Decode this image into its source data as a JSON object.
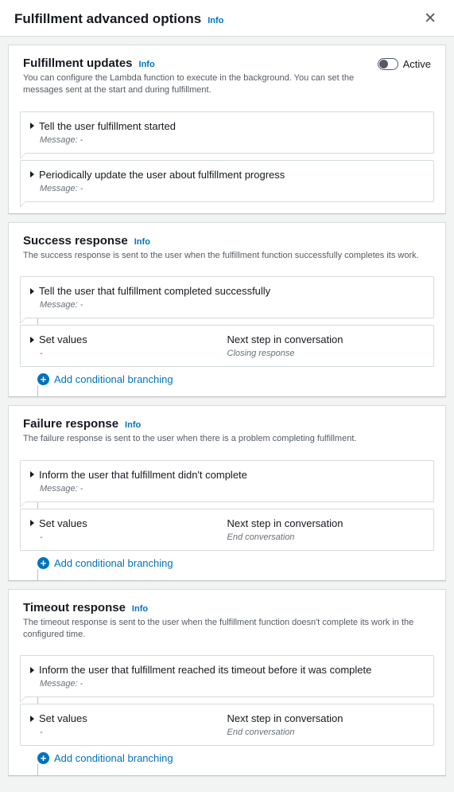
{
  "header": {
    "title": "Fulfillment advanced options",
    "info": "Info"
  },
  "sections": {
    "updates": {
      "title": "Fulfillment updates",
      "info": "Info",
      "desc": "You can configure the Lambda function to execute in the background. You can set the messages sent at the start and during fulfillment.",
      "toggle_label": "Active",
      "rows": {
        "started": {
          "title": "Tell the user fulfillment started",
          "msg": "Message: -"
        },
        "progress": {
          "title": "Periodically update the user about fulfillment progress",
          "msg": "Message: -"
        }
      }
    },
    "success": {
      "title": "Success response",
      "info": "Info",
      "desc": "The success response is sent to the user when the fulfillment function successfully completes its work.",
      "rows": {
        "tell": {
          "title": "Tell the user that fulfillment completed successfully",
          "msg": "Message: -"
        },
        "set": {
          "title": "Set values",
          "sub": "-"
        },
        "next": {
          "title": "Next step in conversation",
          "sub": "Closing response"
        }
      },
      "add": "Add conditional branching"
    },
    "failure": {
      "title": "Failure response",
      "info": "Info",
      "desc": "The failure response is sent to the user when there is a problem completing fulfillment.",
      "rows": {
        "tell": {
          "title": "Inform the user that fulfillment didn't complete",
          "msg": "Message: -"
        },
        "set": {
          "title": "Set values",
          "sub": "-"
        },
        "next": {
          "title": "Next step in conversation",
          "sub": "End conversation"
        }
      },
      "add": "Add conditional branching"
    },
    "timeout": {
      "title": "Timeout response",
      "info": "Info",
      "desc": "The timeout response is sent to the user when the fulfillment function doesn't complete its work in the configured time.",
      "rows": {
        "tell": {
          "title": "Inform the user that fulfillment reached its timeout before it was complete",
          "msg": "Message: -"
        },
        "set": {
          "title": "Set values",
          "sub": "-"
        },
        "next": {
          "title": "Next step in conversation",
          "sub": "End conversation"
        }
      },
      "add": "Add conditional branching"
    }
  }
}
